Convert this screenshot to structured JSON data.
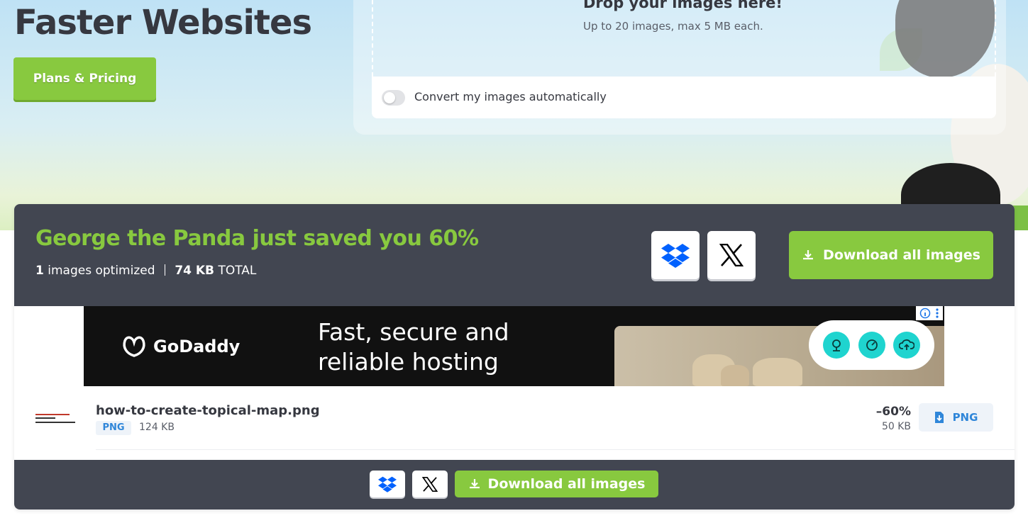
{
  "hero": {
    "title": "Faster Websites",
    "plans_button": "Plans & Pricing"
  },
  "dropzone": {
    "title": "Drop your images here!",
    "subtitle": "Up to 20 images, max 5 MB each.",
    "convert_label": "Convert my images automatically",
    "convert_enabled": false
  },
  "summary": {
    "headline": "George the Panda just saved you 60%",
    "images_count": "1",
    "images_label": "images optimized",
    "total_size": "74 KB",
    "total_label": "TOTAL",
    "download_all_label": "Download all images"
  },
  "ad": {
    "brand": "GoDaddy",
    "headline": "Fast, secure and reliable hosting"
  },
  "files": [
    {
      "name": "how-to-create-topical-map.png",
      "type": "PNG",
      "original_size": "124 KB",
      "saving": "–60%",
      "new_size": "50 KB",
      "download_label": "PNG"
    }
  ],
  "footer": {
    "download_all_label": "Download all images"
  },
  "colors": {
    "accent_green": "#88c93f",
    "panel_dark": "#424651",
    "link_blue": "#2f86d9",
    "dropbox_blue": "#0061fe",
    "ad_teal": "#1fd4cf"
  },
  "icons": [
    "dropbox-icon",
    "x-logo-icon",
    "download-icon",
    "file-download-icon",
    "godaddy-logo-icon",
    "info-icon",
    "more-icon",
    "hosting-icon",
    "speed-icon",
    "cloud-upload-icon"
  ]
}
